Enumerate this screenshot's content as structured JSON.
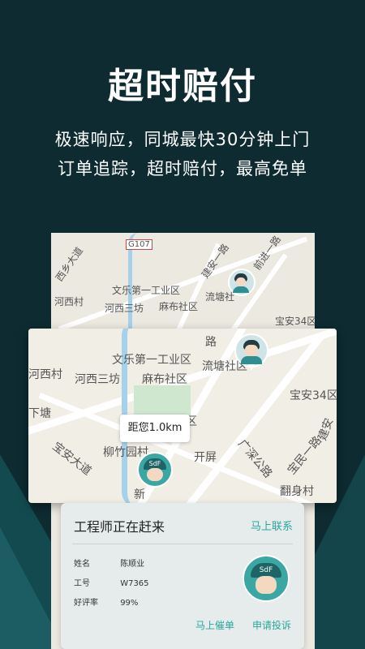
{
  "headline": "超时赔付",
  "subtitle_1": "极速响应，同城最快30分钟上门",
  "subtitle_2": "订单追踪，超时赔付，最高免单",
  "map_small_labels": [
    "G107",
    "西乡大道",
    "建安一路",
    "前进一路",
    "文乐第一工业区",
    "流塘社",
    "河西村",
    "河西三坊",
    "麻布社区",
    "宝安34区"
  ],
  "map_big_labels": [
    "路",
    "文乐第一工业区",
    "流塘社区",
    "河西村",
    "河西三坊",
    "麻布社区",
    "宝安34区",
    "下塘",
    "区",
    "宝安大道",
    "柳竹园村",
    "开屏",
    "广深公路",
    "宝民一路",
    "建安",
    "翻身村",
    "新"
  ],
  "distance_bubble": "距您1.0km",
  "pin_cap_text": "SdF",
  "card": {
    "title": "工程师正在赶来",
    "contact_label": "马上联系",
    "name_label": "姓名",
    "name_value": "陈顺业",
    "id_label": "工号",
    "id_value": "W7365",
    "rating_label": "好评率",
    "rating_value": "99%",
    "avatar_cap": "SdF",
    "urge_button": "马上催单",
    "complain_button": "申请投诉"
  },
  "colors": {
    "background": "#0d2b30",
    "accent": "#2aa59e"
  }
}
